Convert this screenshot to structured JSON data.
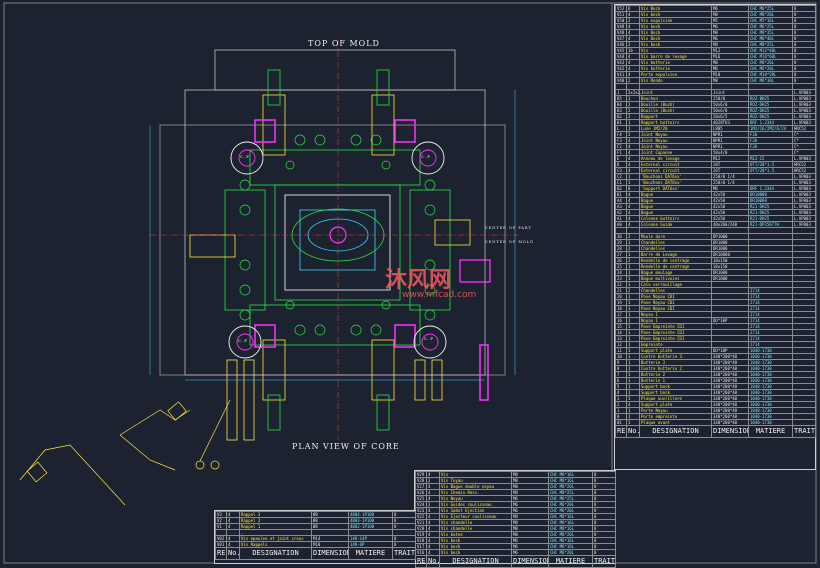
{
  "labels": {
    "top_of_mold": "TOP OF MOLD",
    "plan_view": "PLAN VIEW OF CORE",
    "watermark_cn": "沐风网",
    "watermark_url": "www.mfcad.com"
  },
  "callouts": {
    "cp": "C.P",
    "cp_offset": "C.P\nOFFSET",
    "center_part": "CENTER OF PART",
    "center_mold": "CENTER OF MOLD"
  },
  "bom_header": {
    "rep": "REP",
    "no": "No.",
    "designation": "DESIGNATION",
    "dimensions": "DIMENSIONS",
    "matiere": "MATIERE",
    "traitement": "TRAIT."
  },
  "bom_right": [
    [
      "V52",
      "6",
      "Vis Bock",
      "M6",
      "CHC M6*25L",
      "8"
    ],
    [
      "V51",
      "4",
      "Vis bock",
      "M8",
      "CHC M8*20L",
      "8"
    ],
    [
      "V50",
      "2",
      "Vis expulsion",
      "M5",
      "CHC M5*16L",
      "8"
    ],
    [
      "V49",
      "4",
      "Vis bock",
      "M6",
      "CHC M6*25L",
      "8"
    ],
    [
      "V48",
      "4",
      "Vis Bock",
      "M8",
      "CHC M8*35L",
      "8"
    ],
    [
      "V47",
      "4",
      "Vis Bock",
      "M6",
      "CHC M6*40L",
      "8"
    ],
    [
      "V46",
      "2",
      "Vis bock",
      "M8",
      "CHC M8*25L",
      "8"
    ],
    [
      "V45",
      "16",
      "Vis",
      "M12",
      "CHC M12*40L",
      "8"
    ],
    [
      "V44",
      "4",
      "Vis barre de levage",
      "M16",
      "CHC M16*60L",
      "8"
    ],
    [
      "V43",
      "4",
      "Vis butterie",
      "M8",
      "CHC M8*20L",
      "8"
    ],
    [
      "V42",
      "4",
      "Vis butterie",
      "M6",
      "CHC M6*20L",
      "8"
    ],
    [
      "V41",
      "4",
      "Porte expulsion",
      "M10",
      "CHC M10*20L",
      "8"
    ],
    [
      "V40",
      "2",
      "Vis Rondo",
      "M8",
      "CHC M8*30L",
      "8"
    ],
    [
      "",
      "",
      " ",
      "",
      "",
      ""
    ],
    [
      "J",
      "2x2x2x4",
      "Joint",
      "Joint",
      "",
      "L.VP003"
    ],
    [
      "B5",
      "1",
      "Bouchon",
      "250/0",
      "ROZ-BH25",
      "L.VP003"
    ],
    [
      "B4",
      "2",
      "Douille (Bush)",
      "50x6/0",
      "ROZ-DH25",
      "L.VP003"
    ],
    [
      "B3",
      "2",
      "Douille (Bush)",
      "50x6/0",
      "ROZ-DH25",
      "L.VP003"
    ],
    [
      "B2",
      "2",
      "Rapport",
      "20x6/5",
      "ROZ-DH25",
      "L.VP003"
    ],
    [
      "B1",
      "1",
      "Rapport buttoirs",
      "4028TU3",
      "DRF 1.2344",
      "L.VP003"
    ],
    [
      "L",
      "1",
      "Lune 1M2/20",
      "L805",
      "1M2/16/2M2/6/24",
      "HRC52"
    ],
    [
      "F4",
      "2",
      "Joint Noyau",
      "NPR1",
      "F36",
      "C*"
    ],
    [
      "F3",
      "4",
      "Joint Noyau",
      "NPR1",
      "F36",
      "C*"
    ],
    [
      "F2",
      "4",
      "Joint Noyau",
      "NPR1",
      "F36",
      "C*"
    ],
    [
      "F1",
      "4",
      "Joint Capanne",
      "50x4/0",
      "",
      "C*"
    ],
    [
      "E",
      "4",
      "Anneau de levage",
      "M12",
      "M12-15",
      "L.VP003"
    ],
    [
      "D",
      "4",
      "External circuit",
      "20T",
      "OTT/20*1.5",
      "HRC52"
    ],
    [
      "C3",
      "4",
      "External circuit",
      "20T",
      "OTT/20*1.5",
      "HRC52"
    ],
    [
      "C2",
      "1",
      "'Bouchons DAT6xx'",
      "250/0 1/4",
      "",
      "L.VP003"
    ],
    [
      "C1",
      "1",
      "'Bouchons DAT8xx'",
      "250/0 1/4",
      "",
      "L.VP003"
    ],
    [
      "B2",
      "8",
      "'Support DAT6xx'",
      "M6",
      "DRF 1.2344",
      "L.VP003"
    ],
    [
      "B1",
      "4",
      "Bague",
      "42x50",
      "DR10080",
      "L.VP003"
    ],
    [
      "A4",
      "4",
      "Bague",
      "42x50",
      "DR10080",
      "L.VP003"
    ],
    [
      "A3",
      "4",
      "Bague",
      "42x50",
      "R21-DH25",
      "L.VP003"
    ],
    [
      "A2",
      "4",
      "Bague",
      "42x50",
      "R21-DH25",
      "L.VP003"
    ],
    [
      "A1",
      "4",
      "Colonne buttoirs",
      "42x50",
      "R21-DH25",
      "L.VP003"
    ],
    [
      "A0",
      "4",
      "Colonne Guide",
      "40x260/240",
      "R21-DP25077H",
      "L.VP003"
    ],
    [
      "",
      "",
      " ",
      "",
      "",
      ""
    ],
    [
      "30",
      "2",
      "Moule dure",
      "DP1000",
      "",
      ""
    ],
    [
      "29",
      "1",
      "Chandelles",
      "DR1000",
      "",
      ""
    ],
    [
      "28",
      "2",
      "Chandelles",
      "DR1000",
      "",
      ""
    ],
    [
      "27",
      "1",
      "Barre de Levage",
      "DR10080",
      "",
      ""
    ],
    [
      "26",
      "2",
      "Rondelle de centrage",
      "10x150",
      "",
      ""
    ],
    [
      "25",
      "1",
      "Rondelle de centrage",
      "10x150",
      "",
      ""
    ],
    [
      "24",
      "1",
      "Bague moulage",
      "DR1000",
      "",
      ""
    ],
    [
      "23",
      "1",
      "Bague multivoies",
      "DR1000",
      "",
      ""
    ],
    [
      "22",
      "1",
      "Cale verrouillage",
      "",
      "",
      ""
    ],
    [
      "21",
      "2",
      "Chandelles",
      "",
      "2714",
      ""
    ],
    [
      "20",
      "1",
      "Pave Noyau CDI",
      "",
      "2714",
      ""
    ],
    [
      "19",
      "1",
      "Pave Noyau CDI",
      "",
      "2714",
      ""
    ],
    [
      "18",
      "1",
      "Pave Noyau CDI",
      "",
      "2714",
      ""
    ],
    [
      "17",
      "1",
      "Noyau 1",
      "",
      "2714",
      ""
    ],
    [
      "16",
      "1",
      "Noyau 1",
      "DD*10P",
      "2714",
      ""
    ],
    [
      "15",
      "1",
      "Pave Empreinte CDI",
      "",
      "2714",
      ""
    ],
    [
      "14",
      "1",
      "Pave Empreinte CDI",
      "",
      "2714",
      ""
    ],
    [
      "13",
      "1",
      "Pave Empreinte CDI",
      "",
      "2714",
      ""
    ],
    [
      "12",
      "1",
      "Empreinte",
      "",
      "2714",
      ""
    ],
    [
      "11",
      "1",
      "Support plate",
      "DD*10P",
      "1040-1730",
      ""
    ],
    [
      "10",
      "1",
      "Contre butterie 3",
      "340*200*40",
      "1040-1730",
      ""
    ],
    [
      "9",
      "1",
      "Butterie 3",
      "340*200*40",
      "1040-1730",
      ""
    ],
    [
      "8",
      "1",
      "Contre butterie 2",
      "340*200*40",
      "1040-1730",
      ""
    ],
    [
      "7",
      "1",
      "Butterie 2",
      "340*200*40",
      "1040-1730",
      ""
    ],
    [
      "6",
      "1",
      "Butterie 1",
      "340*200*40",
      "1040-1730",
      ""
    ],
    [
      "5",
      "1",
      "Support bock",
      "340*200*40",
      "1040-1730",
      ""
    ],
    [
      "4",
      "1",
      "Support bock",
      "340*200*40",
      "1040-1730",
      ""
    ],
    [
      "3",
      "1",
      "Plaque ouvrillere",
      "340*200*40",
      "1040-1730",
      ""
    ],
    [
      "2",
      "4",
      "Support plate",
      "340*200*40",
      "1040-1730",
      ""
    ],
    [
      "1",
      "1",
      "Porte Noyau",
      "340*200*40",
      "1040-1730",
      ""
    ],
    [
      "0",
      "1",
      "Porte empreinte",
      "340*200*40",
      "1040-1730",
      ""
    ],
    [
      "01",
      "1",
      "Plaque avant",
      "340*200*40",
      "1040-1730",
      ""
    ]
  ],
  "bom_bottom_mid": [
    [
      "V29",
      "4",
      "Vis",
      "M8",
      "CHC M8*16L",
      "8"
    ],
    [
      "V28",
      "2",
      "Vis Tuyau",
      "M8",
      "CHC M8*16L",
      "8"
    ],
    [
      "V27",
      "4",
      "Vis Bague double noyau",
      "M8",
      "CHC M8*20L",
      "8"
    ],
    [
      "V26",
      "4",
      "Vis Chemin Ress.",
      "M8",
      "CHC M8*25L",
      "8"
    ],
    [
      "V25",
      "4",
      "Vis Noyau",
      "M6",
      "CHC M6*25L",
      "8"
    ],
    [
      "V24",
      "2",
      "Vis Guides coulisseau",
      "M6",
      "CHC M6*20L",
      "8"
    ],
    [
      "V23",
      "4",
      "Vis Sabot Ejection",
      "M6",
      "CHC M6*20L",
      "8"
    ],
    [
      "V22",
      "4",
      "Vis Ejecteur coulisseau",
      "M8",
      "CHC M8*16L",
      "8"
    ],
    [
      "V21",
      "4",
      "Vis chandelle",
      "M8",
      "CHC M8*16L",
      "8"
    ],
    [
      "V20",
      "4",
      "Vis chandelle",
      "M8",
      "CHC M8*16L",
      "8"
    ],
    [
      "V19",
      "4",
      "Vis butee",
      "M8",
      "CHC M8*20L",
      "8"
    ],
    [
      "V18",
      "4",
      "Vis bock",
      "M6",
      "CHC M6*16L",
      "8"
    ],
    [
      "V17",
      "4",
      "Vis bock",
      "M6",
      "CHC M6*16L",
      "8"
    ],
    [
      "V16",
      "4",
      "Vis bock",
      "M6",
      "CHC M6*20L",
      "8"
    ]
  ],
  "bom_bottom_left": [
    [
      "V3",
      "4",
      "Rappel 3",
      "Ø8",
      "4004-1P100",
      "8"
    ],
    [
      "V2",
      "4",
      "Rappel 2",
      "Ø8",
      "4003-1P100",
      "8"
    ],
    [
      "V1",
      "4",
      "Rappel 1",
      "Ø8",
      "4002-1P100",
      "8"
    ],
    [
      "",
      "",
      ".",
      "",
      "",
      ""
    ],
    [
      "V02",
      "4",
      "Vis epaulee et joint crous",
      "M14",
      "14K-14P",
      "8"
    ],
    [
      "V01",
      "4",
      "Vis Rappels",
      "M10",
      "14K-6P",
      "8"
    ]
  ],
  "colors": {
    "background": "#1d2230",
    "plate": "#9a9a9a",
    "green": "#22e83a",
    "magenta": "#ff33ff",
    "yellow": "#ffe63a",
    "cyan": "#38d8ff",
    "white": "#f2f2f2"
  }
}
